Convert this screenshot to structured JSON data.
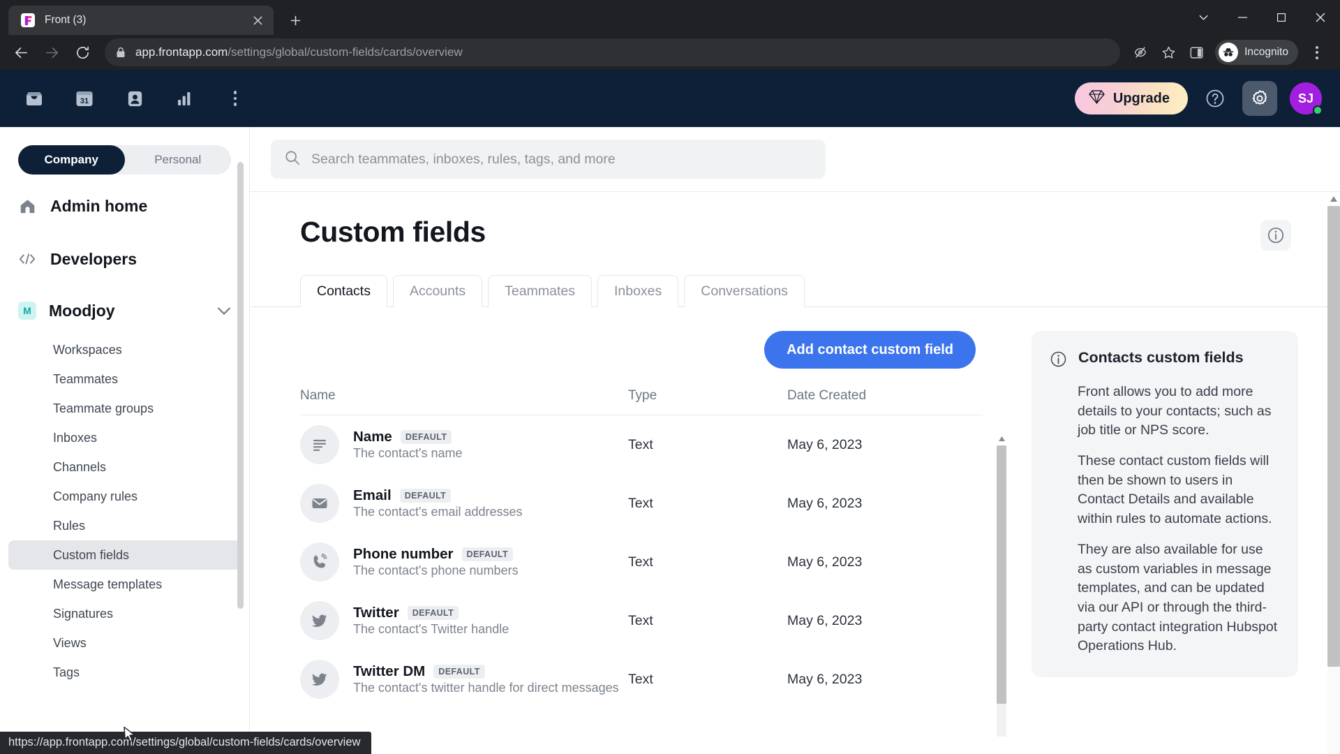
{
  "browser": {
    "tab": {
      "title": "Front (3)",
      "favicon": "front-logo-icon",
      "close_label": "×"
    },
    "new_tab_label": "+",
    "window_controls": {
      "minimize": "minimize-icon",
      "maximize": "maximize-icon",
      "close": "close-icon",
      "list": "tab-search-icon"
    },
    "nav": {
      "back": "back-arrow-icon",
      "forward": "forward-arrow-icon",
      "reload": "reload-icon"
    },
    "address": {
      "lock_icon": "lock-icon",
      "domain": "app.frontapp.com",
      "path": "/settings/global/custom-fields/cards/overview"
    },
    "omnibar_icons": [
      "tracking-protection-icon",
      "bookmark-star-icon",
      "side-panel-icon"
    ],
    "incognito_label": "Incognito",
    "menu_label": "chrome-menu-icon",
    "status_url": "https://app.frontapp.com/settings/global/custom-fields/cards/overview"
  },
  "topnav": {
    "icons": [
      {
        "name": "inbox-icon",
        "label": "Inbox"
      },
      {
        "name": "calendar-icon",
        "label": "31"
      },
      {
        "name": "contacts-icon",
        "label": "Contacts"
      },
      {
        "name": "analytics-icon",
        "label": "Analytics"
      },
      {
        "name": "more-options-icon",
        "label": "More"
      }
    ],
    "upgrade_label": "Upgrade",
    "upgrade_icon": "diamond-icon",
    "help_icon": "help-circle-icon",
    "settings_icon": "gear-icon",
    "avatar_initials": "SJ"
  },
  "sidebar": {
    "segments": [
      {
        "label": "Company",
        "active": true
      },
      {
        "label": "Personal",
        "active": false
      }
    ],
    "major": [
      {
        "label": "Admin home",
        "icon": "home-icon"
      },
      {
        "label": "Developers",
        "icon": "code-icon"
      }
    ],
    "org": {
      "badge": "M",
      "name": "Moodjoy",
      "chevron": "chevron-down-icon"
    },
    "items": [
      {
        "label": "Workspaces",
        "active": false
      },
      {
        "label": "Teammates",
        "active": false
      },
      {
        "label": "Teammate groups",
        "active": false
      },
      {
        "label": "Inboxes",
        "active": false
      },
      {
        "label": "Channels",
        "active": false
      },
      {
        "label": "Company rules",
        "active": false
      },
      {
        "label": "Rules",
        "active": false
      },
      {
        "label": "Custom fields",
        "active": true
      },
      {
        "label": "Message templates",
        "active": false
      },
      {
        "label": "Signatures",
        "active": false
      },
      {
        "label": "Views",
        "active": false
      },
      {
        "label": "Tags",
        "active": false
      }
    ]
  },
  "search": {
    "placeholder": "Search teammates, inboxes, rules, tags, and more",
    "icon": "search-icon"
  },
  "page": {
    "title": "Custom fields",
    "info_icon": "info-circle-icon",
    "tabs": [
      {
        "label": "Contacts",
        "active": true
      },
      {
        "label": "Accounts",
        "active": false
      },
      {
        "label": "Teammates",
        "active": false
      },
      {
        "label": "Inboxes",
        "active": false
      },
      {
        "label": "Conversations",
        "active": false
      }
    ],
    "add_button": "Add contact custom field",
    "table": {
      "headers": {
        "name": "Name",
        "type": "Type",
        "date": "Date Created"
      },
      "rows": [
        {
          "icon": "text-lines-icon",
          "name": "Name",
          "badge": "DEFAULT",
          "description": "The contact's name",
          "type": "Text",
          "date": "May 6, 2023"
        },
        {
          "icon": "envelope-icon",
          "name": "Email",
          "badge": "DEFAULT",
          "description": "The contact's email addresses",
          "type": "Text",
          "date": "May 6, 2023"
        },
        {
          "icon": "phone-icon",
          "name": "Phone number",
          "badge": "DEFAULT",
          "description": "The contact's phone numbers",
          "type": "Text",
          "date": "May 6, 2023"
        },
        {
          "icon": "twitter-bird-icon",
          "name": "Twitter",
          "badge": "DEFAULT",
          "description": "The contact's Twitter handle",
          "type": "Text",
          "date": "May 6, 2023"
        },
        {
          "icon": "twitter-bird-icon",
          "name": "Twitter DM",
          "badge": "DEFAULT",
          "description": "The contact's twitter handle for direct messages",
          "type": "Text",
          "date": "May 6, 2023"
        }
      ]
    },
    "info_panel": {
      "icon": "info-circle-icon",
      "title": "Contacts custom fields",
      "paragraphs": [
        "Front allows you to add more details to your contacts; such as job title or NPS score.",
        "These contact custom fields will then be shown to users in Contact Details and available within rules to automate actions.",
        "They are also available for use as custom variables in message templates, and can be updated via our API or through the third-party contact integration Hubspot Operations Hub."
      ]
    }
  },
  "colors": {
    "front_navy": "#0e2038",
    "accent_blue": "#3b74ec",
    "avatar_purple": "#a31fdf",
    "status_green": "#37d06a",
    "org_teal": "#16a9a0"
  }
}
